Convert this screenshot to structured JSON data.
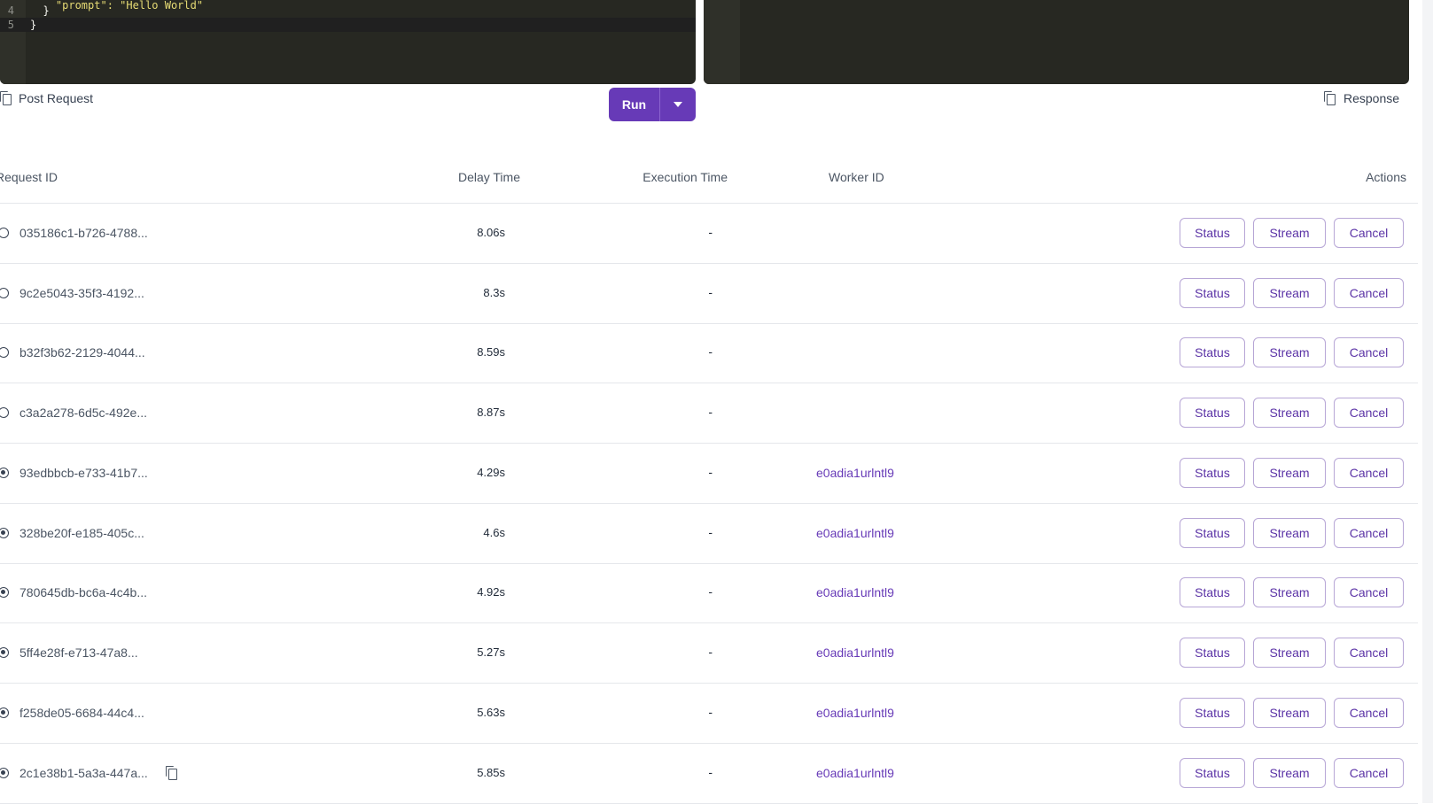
{
  "editor_left": {
    "lines": [
      {
        "num": "4",
        "code": "  }"
      },
      {
        "num": "5",
        "code": "}"
      }
    ]
  },
  "post_request_label": "Post Request",
  "response_label": "Response",
  "run_button_label": "Run",
  "table": {
    "headers": {
      "request_id": "Request ID",
      "delay_time": "Delay Time",
      "execution_time": "Execution Time",
      "worker_id": "Worker ID",
      "actions": "Actions"
    },
    "action_labels": {
      "status": "Status",
      "stream": "Stream",
      "cancel": "Cancel"
    },
    "rows": [
      {
        "request_id": "035186c1-b726-4788...",
        "delay": "8.06s",
        "exec": "-",
        "worker": "",
        "state": "queued"
      },
      {
        "request_id": "9c2e5043-35f3-4192...",
        "delay": "8.3s",
        "exec": "-",
        "worker": "",
        "state": "queued"
      },
      {
        "request_id": "b32f3b62-2129-4044...",
        "delay": "8.59s",
        "exec": "-",
        "worker": "",
        "state": "queued"
      },
      {
        "request_id": "c3a2a278-6d5c-492e...",
        "delay": "8.87s",
        "exec": "-",
        "worker": "",
        "state": "queued"
      },
      {
        "request_id": "93edbbcb-e733-41b7...",
        "delay": "4.29s",
        "exec": "-",
        "worker": "e0adia1urlntl9",
        "state": "in-progress"
      },
      {
        "request_id": "328be20f-e185-405c...",
        "delay": "4.6s",
        "exec": "-",
        "worker": "e0adia1urlntl9",
        "state": "in-progress"
      },
      {
        "request_id": "780645db-bc6a-4c4b...",
        "delay": "4.92s",
        "exec": "-",
        "worker": "e0adia1urlntl9",
        "state": "in-progress"
      },
      {
        "request_id": "5ff4e28f-e713-47a8...",
        "delay": "5.27s",
        "exec": "-",
        "worker": "e0adia1urlntl9",
        "state": "in-progress"
      },
      {
        "request_id": "f258de05-6684-44c4...",
        "delay": "5.63s",
        "exec": "-",
        "worker": "e0adia1urlntl9",
        "state": "in-progress"
      },
      {
        "request_id": "2c1e38b1-5a3a-447a...",
        "delay": "5.85s",
        "exec": "-",
        "worker": "e0adia1urlntl9",
        "state": "in-progress",
        "copy_icon": true
      }
    ]
  },
  "colors": {
    "accent": "#673ab7",
    "editor_bg": "#272822",
    "button_border": "#b7a6d6"
  }
}
